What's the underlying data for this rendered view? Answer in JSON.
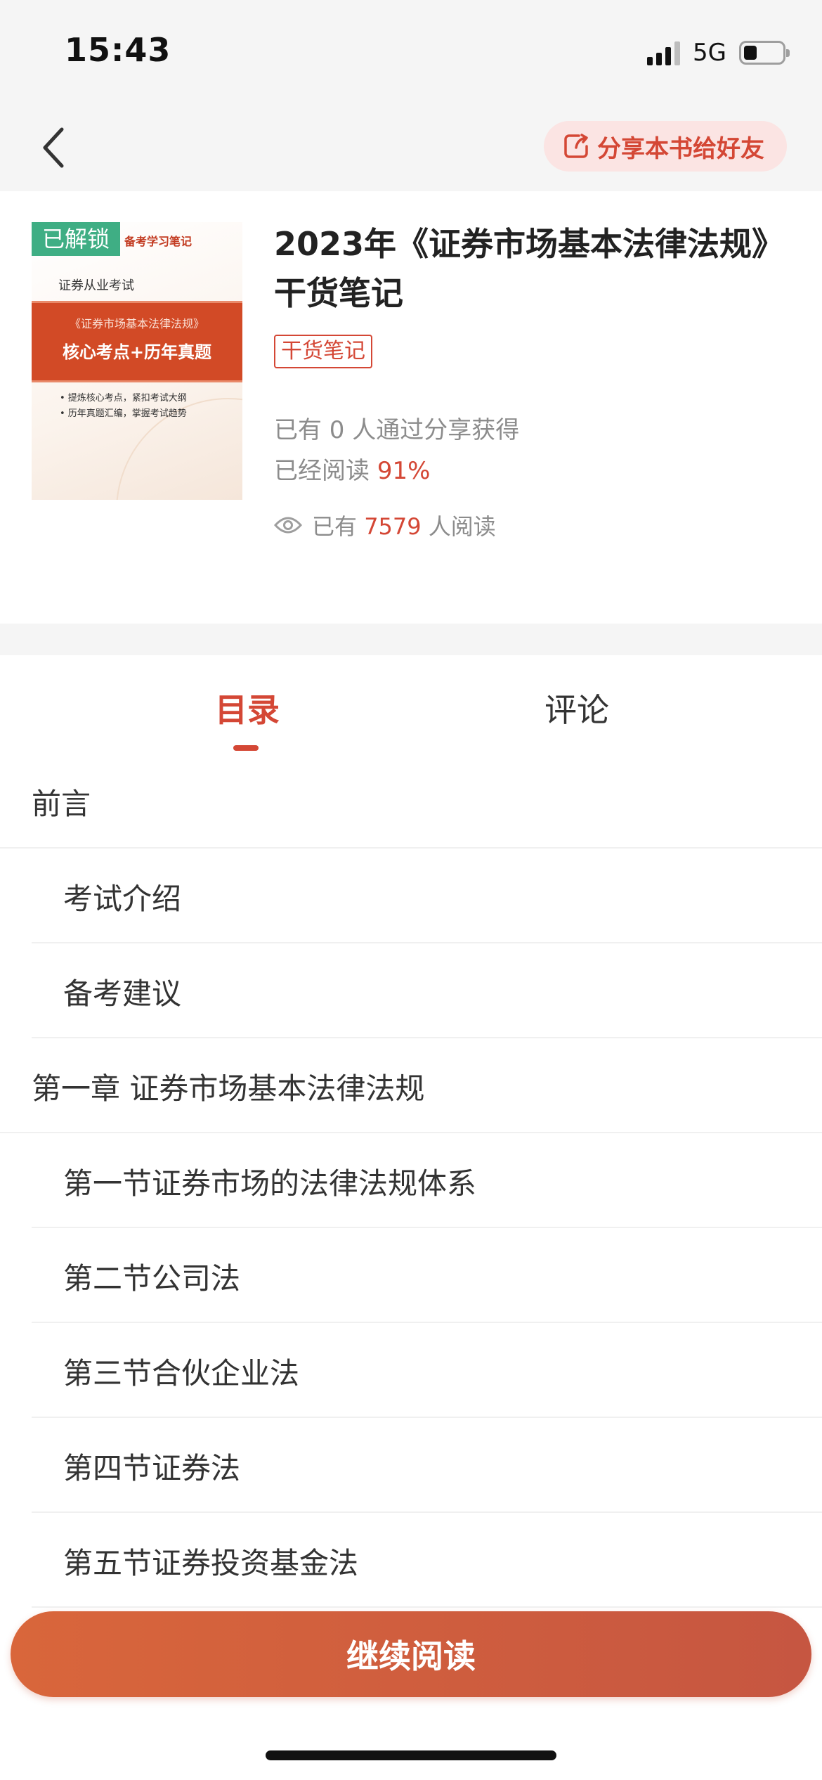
{
  "status_bar": {
    "time": "15:43",
    "network": "5G"
  },
  "nav": {
    "share_label": "分享本书给好友"
  },
  "book": {
    "cover": {
      "unlocked_badge": "已解锁",
      "notes_tag": "备考学习笔记",
      "exam_name": "证券从业考试",
      "banner_sub": "《证券市场基本法律法规》",
      "banner_main": "核心考点+历年真题",
      "bullet_1": "• 提炼核心考点，紧扣考试大纲",
      "bullet_2": "• 历年真题汇编，掌握考试趋势"
    },
    "title": "2023年《证券市场基本法律法规》干货笔记",
    "category": "干货笔记",
    "share_count_text": "已有 0 人通过分享获得",
    "read_progress_prefix": "已经阅读 ",
    "read_progress_value": "91%",
    "readers_prefix": "已有 ",
    "readers_count": "7579",
    "readers_suffix": " 人阅读"
  },
  "tabs": {
    "toc": "目录",
    "comments": "评论"
  },
  "toc": {
    "items": [
      {
        "label": "前言",
        "level": 1
      },
      {
        "label": "考试介绍",
        "level": 2
      },
      {
        "label": "备考建议",
        "level": 2
      },
      {
        "label": "第一章 证券市场基本法律法规",
        "level": 1
      },
      {
        "label": "第一节证券市场的法律法规体系",
        "level": 2
      },
      {
        "label": "第二节公司法",
        "level": 2
      },
      {
        "label": "第三节合伙企业法",
        "level": 2
      },
      {
        "label": "第四节证券法",
        "level": 2
      },
      {
        "label": "第五节证券投资基金法",
        "level": 2
      }
    ]
  },
  "actions": {
    "continue_reading": "继续阅读"
  },
  "colors": {
    "accent": "#d44735",
    "unlocked_badge": "#3fae84",
    "share_button_bg": "#fbe4e3"
  }
}
